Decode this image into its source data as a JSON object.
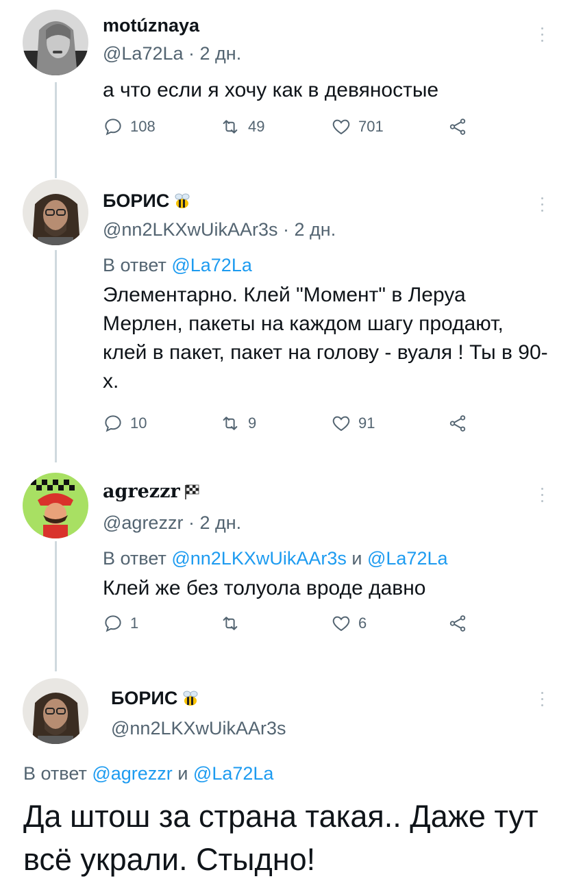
{
  "tweets": [
    {
      "name": "motúznaya",
      "handle": "@La72La",
      "time": "· 2 дн.",
      "text": "а что если я хочу как в девяностые",
      "replies": "108",
      "retweets": "49",
      "likes": "701"
    },
    {
      "name": "БОРИС",
      "name_emoji": "bee-icon",
      "handle": "@nn2LKXwUikAAr3s",
      "time": "· 2 дн.",
      "reply_prefix": "В ответ",
      "reply_mention": "@La72La",
      "text": "Элементарно. Клей \"Момент\" в Леруа Мерлен, пакеты на каждом шагу продают, клей в пакет, пакет на голову - вуаля ! Ты в 90-х.",
      "replies": "10",
      "retweets": "9",
      "likes": "91"
    },
    {
      "name": "agrezzr",
      "name_emoji": "checkered-flag-icon",
      "handle": "@agrezzr",
      "time": "· 2 дн.",
      "reply_prefix": "В ответ",
      "reply_mention_1": "@nn2LKXwUikAAr3s",
      "reply_joiner": "и",
      "reply_mention_2": "@La72La",
      "text": "Клей же без толуола вроде давно",
      "replies": "1",
      "retweets": "",
      "likes": "6"
    },
    {
      "name": "БОРИС",
      "name_emoji": "bee-icon",
      "handle": "@nn2LKXwUikAAr3s",
      "reply_prefix": "В ответ",
      "reply_mention_1": "@agrezzr",
      "reply_joiner": "и",
      "reply_mention_2": "@La72La",
      "text": "Да штош за страна такая.. Даже тут всё украли. Стыдно!"
    }
  ],
  "colors": {
    "text": "#0f1419",
    "secondary": "#536471",
    "link": "#1d9bf0",
    "thread_line": "#cfd9de"
  }
}
